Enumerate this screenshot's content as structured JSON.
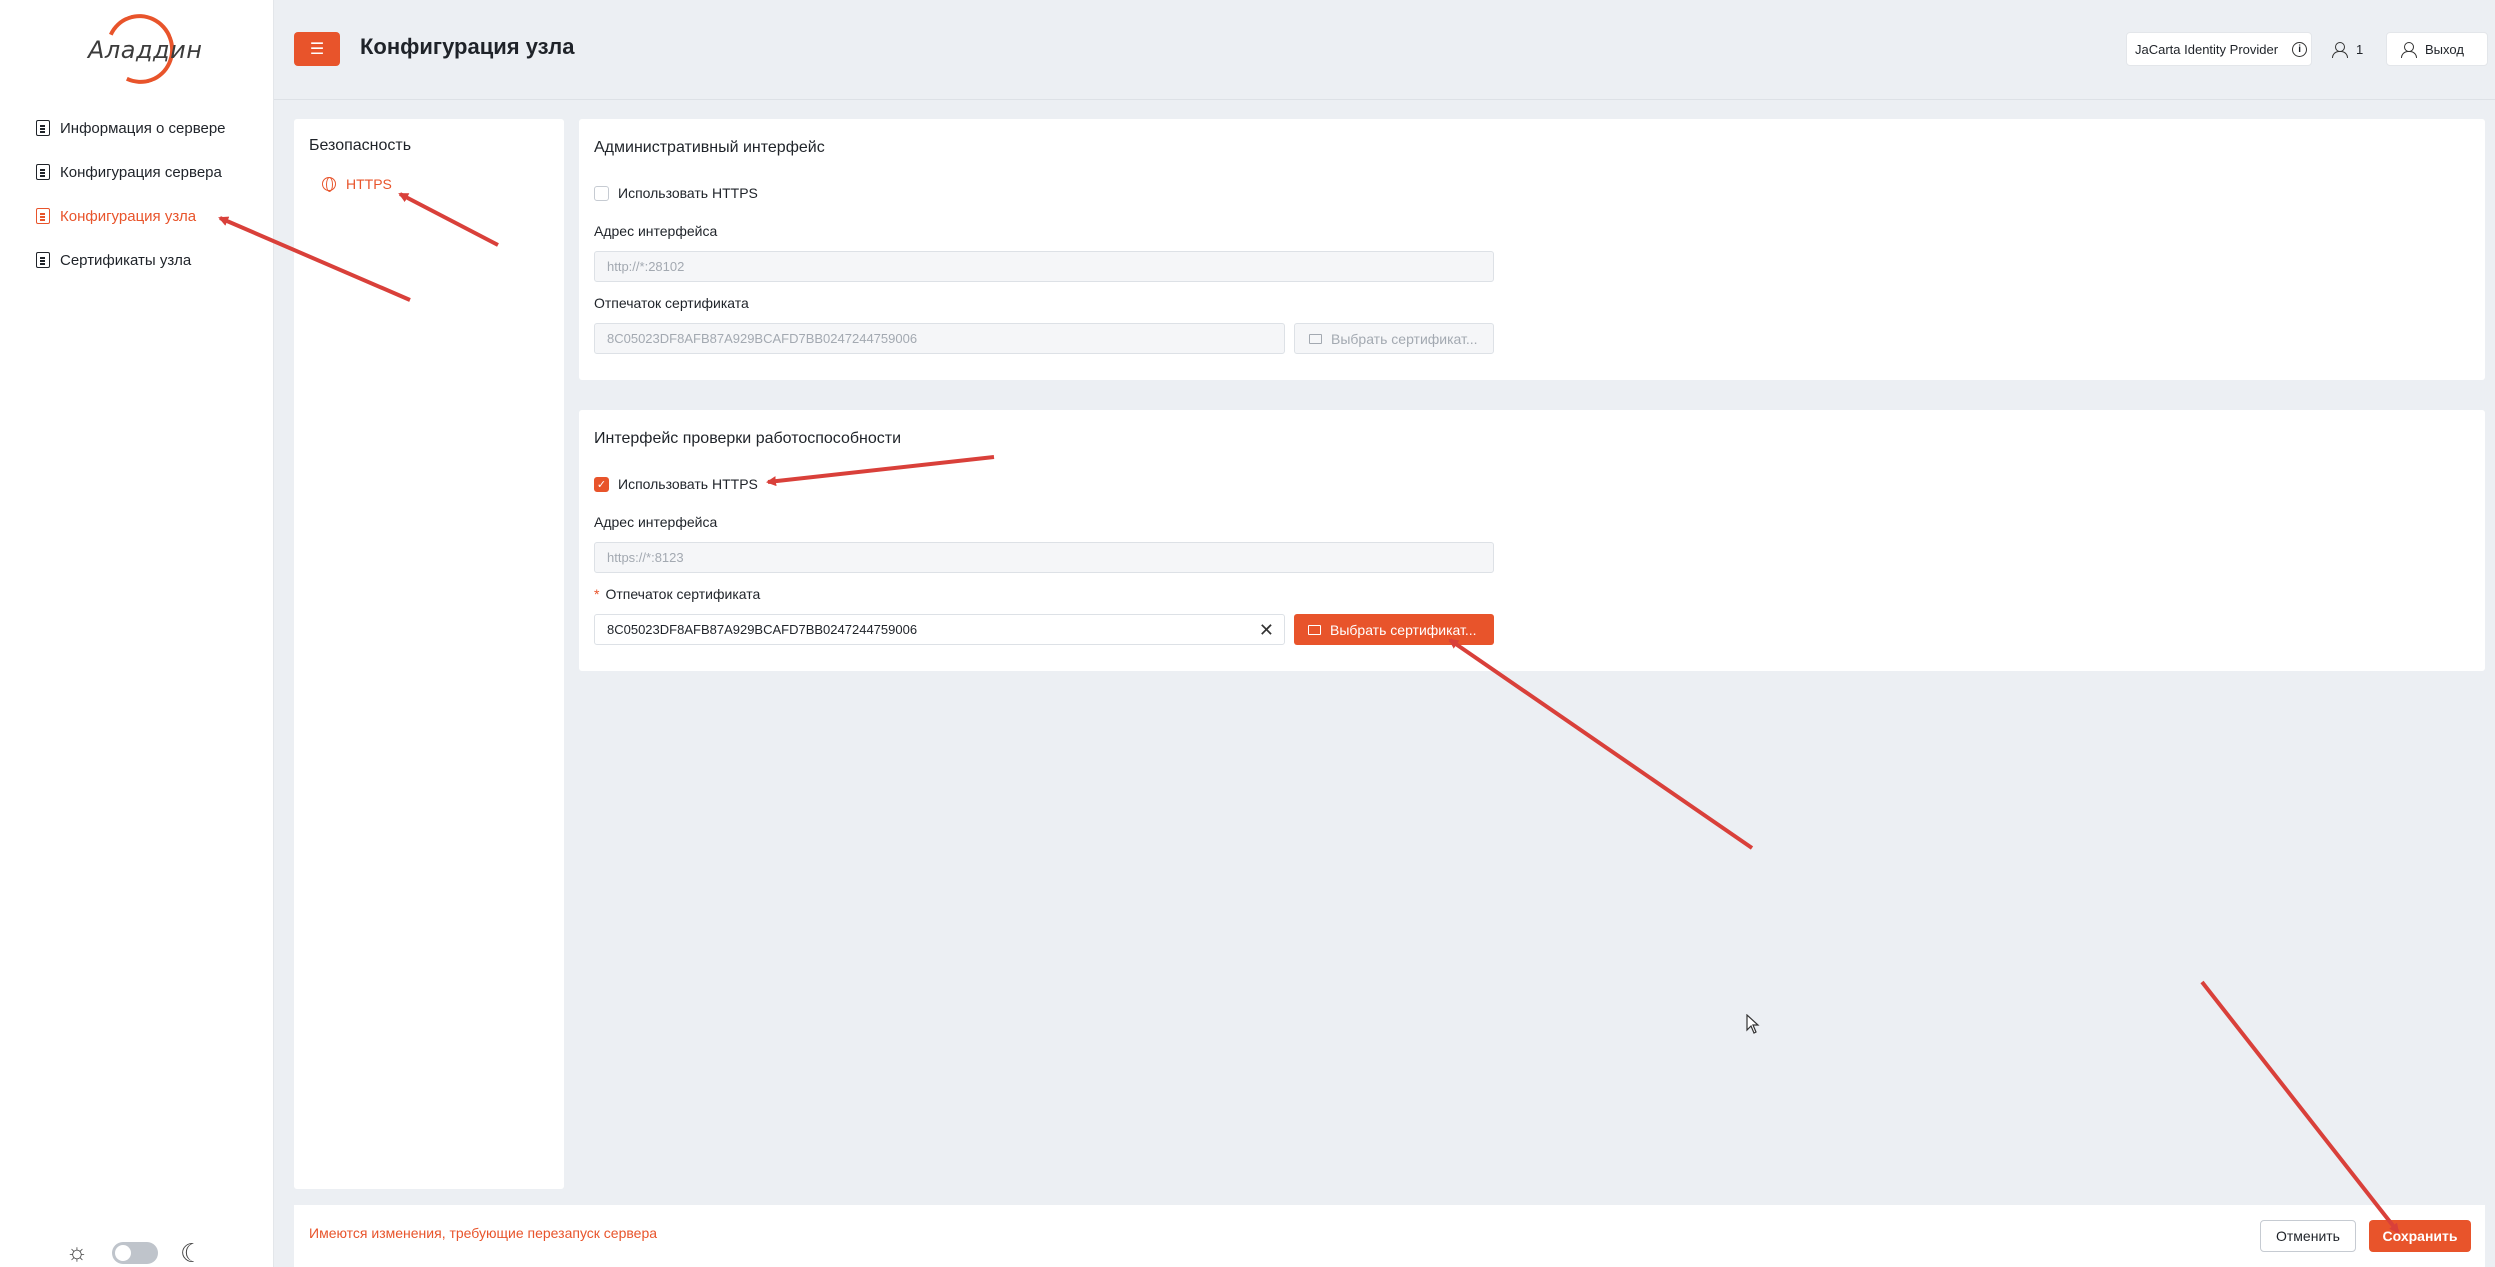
{
  "sidebar": {
    "logo_text": "Аладдин",
    "items": [
      {
        "label": "Информация о сервере",
        "active": false
      },
      {
        "label": "Конфигурация сервера",
        "active": false
      },
      {
        "label": "Конфигурация узла",
        "active": true
      },
      {
        "label": "Сертификаты узла",
        "active": false
      }
    ],
    "theme_icons": [
      "sun-icon",
      "moon-icon"
    ]
  },
  "header": {
    "title": "Конфигурация узла",
    "provider": "JaCarta Identity Provider",
    "user_count": "1",
    "logout_label": "Выход"
  },
  "security_panel": {
    "title": "Безопасность",
    "item_label": "HTTPS"
  },
  "admin_interface": {
    "title": "Административный интерфейс",
    "use_https_label": "Использовать HTTPS",
    "use_https_checked": false,
    "address_label": "Адрес интерфейса",
    "address_placeholder": "http://*:28102",
    "thumbprint_label": "Отпечаток сертификата",
    "thumbprint_value": "8C05023DF8AFB87A929BCAFD7BB0247244759006",
    "select_cert_label": "Выбрать сертификат..."
  },
  "health_interface": {
    "title": "Интерфейс проверки работоспособности",
    "use_https_label": "Использовать HTTPS",
    "use_https_checked": true,
    "address_label": "Адрес интерфейса",
    "address_placeholder": "https://*:8123",
    "thumbprint_required_mark": "*",
    "thumbprint_label": "Отпечаток сертификата",
    "thumbprint_value": "8C05023DF8AFB87A929BCAFD7BB0247244759006",
    "select_cert_label": "Выбрать сертификат..."
  },
  "footer": {
    "message": "Имеются изменения, требующие перезапуск сервера",
    "cancel_label": "Отменить",
    "save_label": "Сохранить"
  },
  "colors": {
    "accent": "#e8542b",
    "annotation_arrow": "#d9403a",
    "background": "#eceff3"
  }
}
